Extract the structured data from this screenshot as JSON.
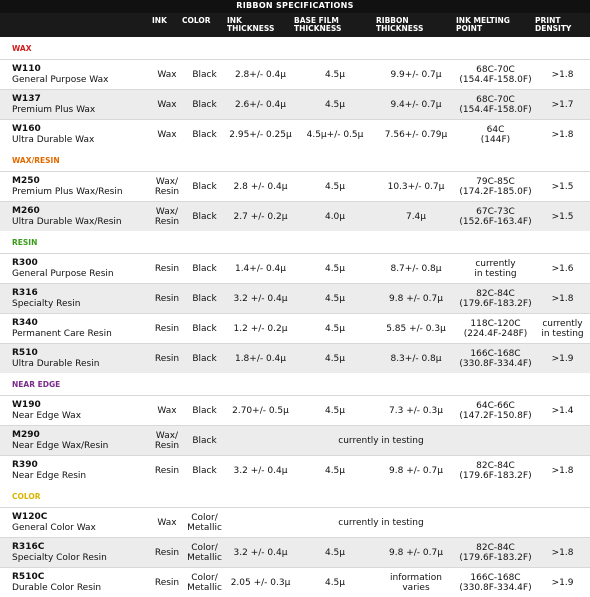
{
  "title": "RIBBON SPECIFICATIONS",
  "headers": [
    "",
    "INK",
    "COLOR",
    "INK\nTHICKNESS",
    "BASE FILM\nTHICKNESS",
    "RIBBON\nTHICKNESS",
    "INK MELTING\nPOINT",
    "PRINT\nDENSITY"
  ],
  "sections": [
    {
      "name": "WAX",
      "color": "#d11f1f",
      "rows": [
        {
          "code": "W110",
          "desc": "General Purpose Wax",
          "ink": "Wax",
          "color": "Black",
          "ink_th": "2.8+/- 0.4µ",
          "base": "4.5µ",
          "ribbon": "9.9+/- 0.7µ",
          "melt": "68C-70C\n(154.4F-158.0F)",
          "density": ">1.8"
        },
        {
          "code": "W137",
          "desc": "Premium Plus Wax",
          "ink": "Wax",
          "color": "Black",
          "ink_th": "2.6+/- 0.4µ",
          "base": "4.5µ",
          "ribbon": "9.4+/- 0.7µ",
          "melt": "68C-70C\n(154.4F-158.0F)",
          "density": ">1.7"
        },
        {
          "code": "W160",
          "desc": "Ultra Durable Wax",
          "ink": "Wax",
          "color": "Black",
          "ink_th": "2.95+/- 0.25µ",
          "base": "4.5µ+/- 0.5µ",
          "ribbon": "7.56+/- 0.79µ",
          "melt": "64C\n(144F)",
          "density": ">1.8"
        }
      ]
    },
    {
      "name": "WAX/RESIN",
      "color": "#e06a00",
      "rows": [
        {
          "code": "M250",
          "desc": "Premium Plus Wax/Resin",
          "ink": "Wax/\nResin",
          "color": "Black",
          "ink_th": "2.8 +/- 0.4µ",
          "base": "4.5µ",
          "ribbon": "10.3+/- 0.7µ",
          "melt": "79C-85C\n(174.2F-185.0F)",
          "density": ">1.5"
        },
        {
          "code": "M260",
          "desc": "Ultra Durable Wax/Resin",
          "ink": "Wax/\nResin",
          "color": "Black",
          "ink_th": "2.7 +/- 0.2µ",
          "base": "4.0µ",
          "ribbon": "7.4µ",
          "melt": "67C-73C\n(152.6F-163.4F)",
          "density": ">1.5"
        }
      ]
    },
    {
      "name": "RESIN",
      "color": "#3a9a1a",
      "rows": [
        {
          "code": "R300",
          "desc": "General Purpose Resin",
          "ink": "Resin",
          "color": "Black",
          "ink_th": "1.4+/- 0.4µ",
          "base": "4.5µ",
          "ribbon": "8.7+/- 0.8µ",
          "melt": "currently\nin testing",
          "density": ">1.6"
        },
        {
          "code": "R316",
          "desc": "Specialty Resin",
          "ink": "Resin",
          "color": "Black",
          "ink_th": "3.2 +/- 0.4µ",
          "base": "4.5µ",
          "ribbon": "9.8 +/- 0.7µ",
          "melt": "82C-84C\n(179.6F-183.2F)",
          "density": ">1.8"
        },
        {
          "code": "R340",
          "desc": "Permanent Care Resin",
          "ink": "Resin",
          "color": "Black",
          "ink_th": "1.2 +/- 0.2µ",
          "base": "4.5µ",
          "ribbon": "5.85 +/- 0.3µ",
          "melt": "118C-120C\n(224.4F-248F)",
          "density": "currently\nin testing"
        },
        {
          "code": "R510",
          "desc": "Ultra Durable Resin",
          "ink": "Resin",
          "color": "Black",
          "ink_th": "1.8+/- 0.4µ",
          "base": "4.5µ",
          "ribbon": "8.3+/- 0.8µ",
          "melt": "166C-168C\n(330.8F-334.4F)",
          "density": ">1.9"
        }
      ]
    },
    {
      "name": "NEAR EDGE",
      "color": "#7a2a8a",
      "rows": [
        {
          "code": "W190",
          "desc": "Near Edge Wax",
          "ink": "Wax",
          "color": "Black",
          "ink_th": "2.70+/- 0.5µ",
          "base": "4.5µ",
          "ribbon": "7.3 +/- 0.3µ",
          "melt": "64C-66C\n(147.2F-150.8F)",
          "density": ">1.4"
        },
        {
          "code": "M290",
          "desc": "Near Edge Wax/Resin",
          "ink": "Wax/\nResin",
          "color": "Black",
          "span": "currently in testing"
        },
        {
          "code": "R390",
          "desc": "Near Edge Resin",
          "ink": "Resin",
          "color": "Black",
          "ink_th": "3.2 +/- 0.4µ",
          "base": "4.5µ",
          "ribbon": "9.8 +/- 0.7µ",
          "melt": "82C-84C\n(179.6F-183.2F)",
          "density": ">1.8"
        }
      ]
    },
    {
      "name": "COLOR",
      "color": "#d9b400",
      "rows": [
        {
          "code": "W120C",
          "desc": "General Color Wax",
          "ink": "Wax",
          "color": "Color/\nMetallic",
          "span": "currently in testing"
        },
        {
          "code": "R316C",
          "desc": "Specialty Color Resin",
          "ink": "Resin",
          "color": "Color/\nMetallic",
          "ink_th": "3.2 +/- 0.4µ",
          "base": "4.5µ",
          "ribbon": "9.8 +/- 0.7µ",
          "melt": "82C-84C\n(179.6F-183.2F)",
          "density": ">1.8"
        },
        {
          "code": "R510C",
          "desc": "Durable Color Resin",
          "ink": "Resin",
          "color": "Color/\nMetallic",
          "ink_th": "2.05 +/- 0.3µ",
          "base": "4.5µ",
          "ribbon": "information\nvaries",
          "melt": "166C-168C\n(330.8F-334.4F)",
          "density": ">1.9"
        }
      ]
    }
  ]
}
